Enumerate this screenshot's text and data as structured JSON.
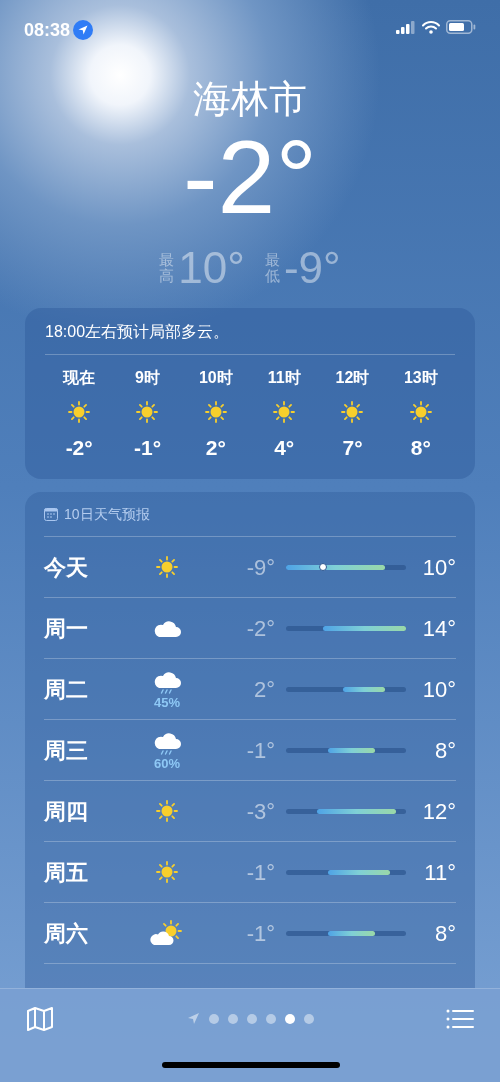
{
  "status_bar": {
    "time": "08:38",
    "location_active": true
  },
  "current": {
    "city": "海林市",
    "temperature": "-2°",
    "high": {
      "label": "最高",
      "value": "10°"
    },
    "low": {
      "label": "最低",
      "value": "-9°"
    }
  },
  "hourly": {
    "summary": "18:00左右预计局部多云。",
    "hours": [
      {
        "label": "现在",
        "kind": "sun",
        "temp": "-2°"
      },
      {
        "label": "9时",
        "kind": "sun",
        "temp": "-1°"
      },
      {
        "label": "10时",
        "kind": "sun",
        "temp": "2°"
      },
      {
        "label": "11时",
        "kind": "sun",
        "temp": "4°"
      },
      {
        "label": "12时",
        "kind": "sun",
        "temp": "7°"
      },
      {
        "label": "13时",
        "kind": "sun",
        "temp": "8°"
      }
    ]
  },
  "daily": {
    "title": "10日天气预报",
    "days": [
      {
        "day": "今天",
        "kind": "sun",
        "low": "-9°",
        "high": "10°",
        "show_current": true
      },
      {
        "day": "周一",
        "kind": "cloud",
        "low": "-2°",
        "high": "14°",
        "show_current": false
      },
      {
        "day": "周二",
        "kind": "rain",
        "precip": "45%",
        "low": "2°",
        "high": "10°",
        "show_current": false
      },
      {
        "day": "周三",
        "kind": "rain",
        "precip": "60%",
        "low": "-1°",
        "high": "8°",
        "show_current": false
      },
      {
        "day": "周四",
        "kind": "sun",
        "low": "-3°",
        "high": "12°",
        "show_current": false
      },
      {
        "day": "周五",
        "kind": "sun",
        "low": "-1°",
        "high": "11°",
        "show_current": false
      },
      {
        "day": "周六",
        "kind": "partly",
        "low": "-1°",
        "high": "8°",
        "show_current": false
      }
    ]
  },
  "pager": [
    {
      "kind": "location",
      "selected": false
    },
    {
      "kind": "dot",
      "selected": false
    },
    {
      "kind": "dot",
      "selected": false
    },
    {
      "kind": "dot",
      "selected": false
    },
    {
      "kind": "dot",
      "selected": false
    },
    {
      "kind": "dot",
      "selected": true
    },
    {
      "kind": "dot",
      "selected": false
    }
  ]
}
